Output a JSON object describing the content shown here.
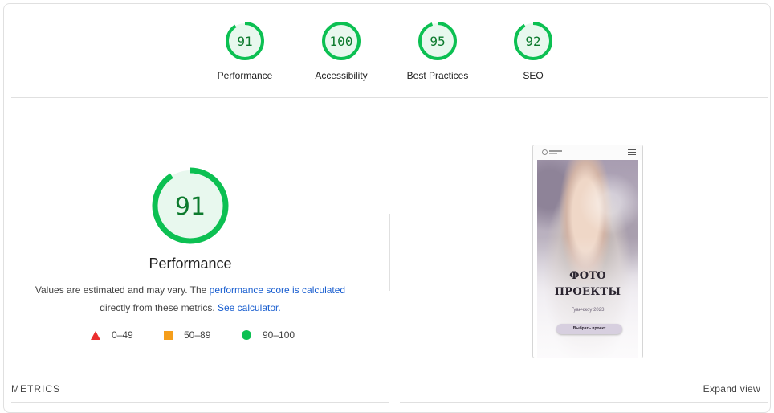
{
  "categories": [
    {
      "label": "Performance",
      "score": 91
    },
    {
      "label": "Accessibility",
      "score": 100
    },
    {
      "label": "Best Practices",
      "score": 95
    },
    {
      "label": "SEO",
      "score": 92
    }
  ],
  "colors": {
    "pass": "#0cc052",
    "pass_text": "#0c7a2d",
    "pass_fill": "#e8f8ee",
    "average": "#f59e1b",
    "fail": "#eb2e2e",
    "link": "#1a5fd0"
  },
  "main": {
    "score": 91,
    "title": "Performance",
    "desc_part1": "Values are estimated and may vary. The ",
    "desc_link1": "performance score is calculated",
    "desc_part2": "directly from these metrics. ",
    "desc_link2": "See calculator."
  },
  "legend": [
    {
      "shape": "triangle",
      "range": "0–49"
    },
    {
      "shape": "square",
      "range": "50–89"
    },
    {
      "shape": "circle",
      "range": "90–100"
    }
  ],
  "screenshot": {
    "title_line1": "ФОТО",
    "title_line2": "ПРОЕКТЫ",
    "subtitle": "Гуанчжоу 2023",
    "button": "Выбрать проект"
  },
  "metrics_label": "METRICS",
  "expand_label": "Expand view"
}
